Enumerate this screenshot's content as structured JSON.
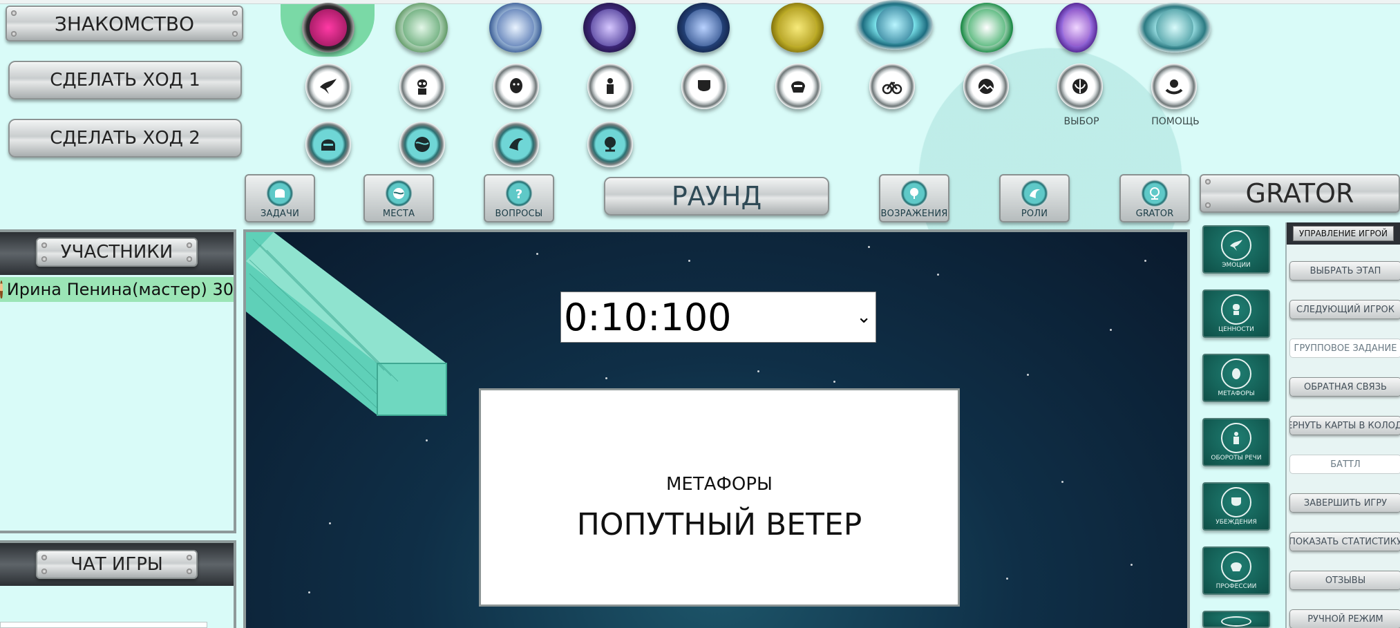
{
  "left_buttons": {
    "acquaintance": "ЗНАКОМСТВО",
    "move1": "СДЕЛАТЬ ХОД 1",
    "move2": "СДЕЛАТЬ ХОД 2"
  },
  "top_icons": {
    "row1": [
      "gem-pink-icon",
      "gem-green-icon",
      "gem-blue-icon",
      "gem-violet-icon",
      "gem-navy-icon",
      "gem-gold-icon",
      "gem-globe-icon",
      "gem-emerald-icon",
      "gem-purple-icon",
      "gem-arch-icon"
    ],
    "row2": [
      "dove-icon",
      "robot-icon",
      "face-icon",
      "statue-icon",
      "mask-icon",
      "helmet-icon",
      "bicycle-icon",
      "landscape-icon",
      "jedi-icon",
      "hand-icon"
    ],
    "row3": [
      "visor-helmet-icon",
      "globe-icon",
      "hand-leaf-icon",
      "globe-stand-icon"
    ],
    "choice_label": "ВЫБОР",
    "help_label": "ПОМОЩЬ"
  },
  "categories": {
    "tasks": "ЗАДАЧИ",
    "places": "МЕСТА",
    "questions": "ВОПРОСЫ",
    "round": "РАУНД",
    "objections": "ВОЗРАЖЕНИЯ",
    "roles": "РОЛИ",
    "grator": "GRATOR"
  },
  "brand": "GRATOR",
  "participants": {
    "title": "УЧАСТНИКИ",
    "players": [
      {
        "name": "Ирина Пенина(мастер) 30"
      }
    ]
  },
  "chat": {
    "title": "ЧАТ ИГРЫ"
  },
  "timer": {
    "value": "0:10:100",
    "chevron": "⌄"
  },
  "card": {
    "category": "МЕТАФОРЫ",
    "text": "ПОПУТНЫЙ ВЕТЕР"
  },
  "side_tiles": [
    "ЭМОЦИИ",
    "ЦЕННОСТИ",
    "МЕТАФОРЫ",
    "ОБОРОТЫ РЕЧИ",
    "УБЕЖДЕНИЯ",
    "ПРОФЕССИИ"
  ],
  "management": {
    "title": "УПРАВЛЕНИЕ ИГРОЙ",
    "buttons": [
      "ВЫБРАТЬ ЭТАП",
      "СЛЕДУЮЩИЙ ИГРОК",
      "ГРУППОВОЕ ЗАДАНИЕ",
      "ОБРАТНАЯ СВЯЗЬ",
      "ВЕРНУТЬ КАРТЫ В КОЛОДЫ",
      "БАТТЛ",
      "ЗАВЕРШИТЬ ИГРУ",
      "ПОКАЗАТЬ СТАТИСТИКУ",
      "ОТЗЫВЫ",
      "РУЧНОЙ РЕЖИМ"
    ]
  },
  "colors": {
    "accent_teal": "#5fd0c4",
    "selected": "#7ad9a6",
    "player_row": "#9be5b6",
    "bg": "#d9fbf8"
  }
}
